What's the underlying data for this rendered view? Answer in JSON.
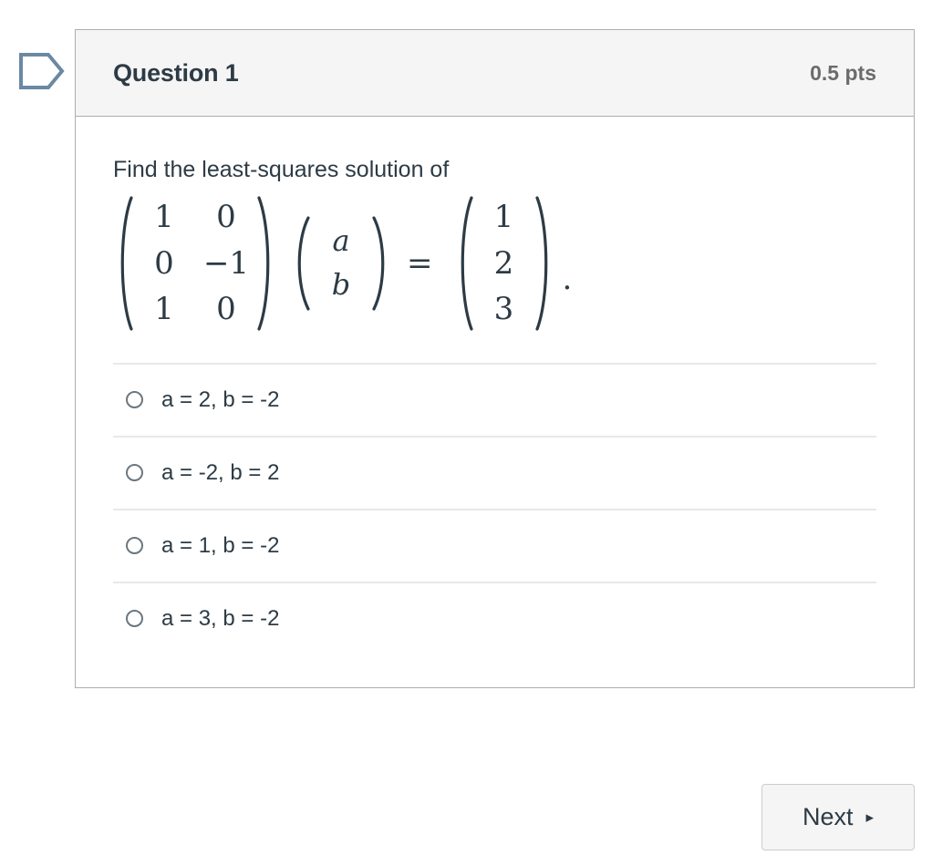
{
  "flag": {
    "icon": "tag-outline-icon",
    "color": "#6a89a3"
  },
  "question": {
    "name": "Question 1",
    "points": "0.5 pts",
    "prompt": "Find the least-squares solution of",
    "equation": {
      "coefficient_matrix": [
        [
          "1",
          "0"
        ],
        [
          "0",
          "−1"
        ],
        [
          "1",
          "0"
        ]
      ],
      "unknown_vector": [
        "a",
        "b"
      ],
      "relation": "=",
      "right_hand_side": [
        "1",
        "2",
        "3"
      ],
      "trailing_punctuation": "."
    },
    "answers": [
      {
        "label": "a = 2, b = -2",
        "selected": false
      },
      {
        "label": "a = -2, b = 2",
        "selected": false
      },
      {
        "label": "a = 1, b = -2",
        "selected": false
      },
      {
        "label": "a = 3, b = -2",
        "selected": false
      }
    ]
  },
  "footer": {
    "next_label": "Next",
    "next_caret": "▸"
  },
  "colors": {
    "text": "#2d3b45",
    "muted": "#6b6b6b",
    "card_border": "#aeaeae",
    "header_bg": "#f5f5f5",
    "divider": "#e8e8e8"
  }
}
